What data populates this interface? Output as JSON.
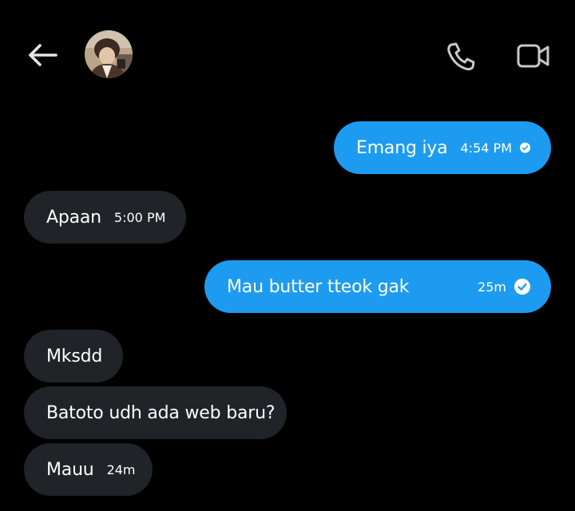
{
  "colors": {
    "background": "#000000",
    "outgoing_bubble": "#1d9bf0",
    "incoming_bubble": "#202327",
    "icon": "#c8c8c8"
  },
  "header": {
    "back_icon": "arrow-left-icon",
    "avatar": "contact-avatar",
    "call_icon": "phone-icon",
    "video_icon": "video-camera-icon"
  },
  "messages": [
    {
      "direction": "outgoing",
      "text": "Emang iya",
      "time": "4:54 PM",
      "status": "read-check-icon"
    },
    {
      "direction": "incoming",
      "text": "Apaan",
      "time": "5:00 PM"
    },
    {
      "direction": "outgoing",
      "text": "Mau butter tteok gak",
      "time": "25m",
      "status": "read-check-icon"
    },
    {
      "direction": "incoming",
      "text": "Mksdd",
      "time": ""
    },
    {
      "direction": "incoming",
      "text": "Batoto udh ada web baru?",
      "time": ""
    },
    {
      "direction": "incoming",
      "text": "Mauu",
      "time": "24m"
    }
  ]
}
